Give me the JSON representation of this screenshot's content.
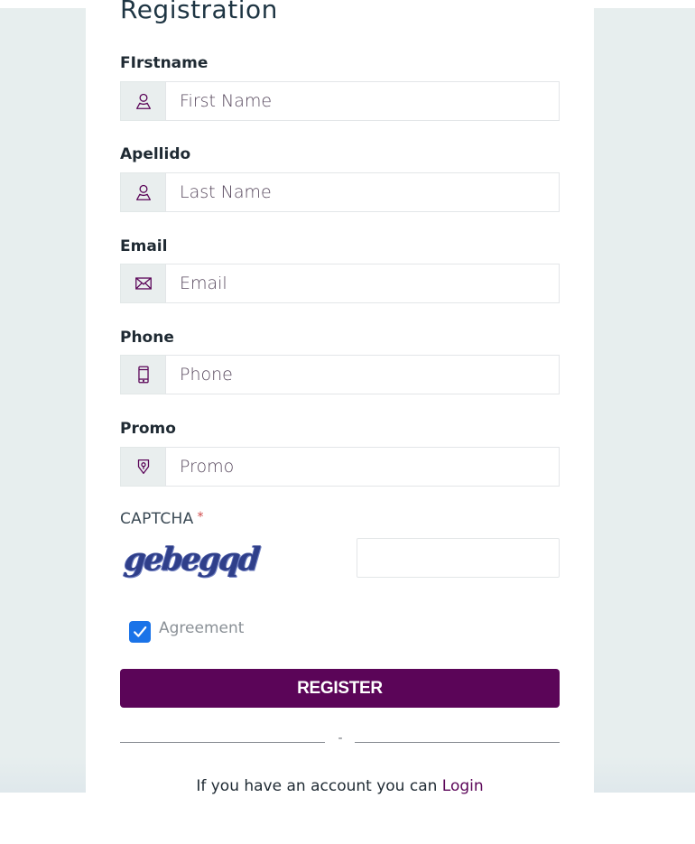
{
  "form": {
    "title": "Registration",
    "fields": [
      {
        "label": "FIrstname",
        "placeholder": "First Name",
        "icon": "user-icon"
      },
      {
        "label": "Apellido",
        "placeholder": "Last Name",
        "icon": "user-icon"
      },
      {
        "label": "Email",
        "placeholder": "Email",
        "icon": "envelope-icon"
      },
      {
        "label": "Phone",
        "placeholder": "Phone",
        "icon": "phone-icon"
      },
      {
        "label": "Promo",
        "placeholder": "Promo",
        "icon": "tag-icon"
      }
    ],
    "captcha": {
      "label": "CAPTCHA",
      "required_mark": "*",
      "image_text": "gebegqd",
      "value": ""
    },
    "agreement": {
      "label": "Agreement",
      "checked": true
    },
    "register_label": "REGISTER",
    "divider_mark": "-",
    "login_prompt": "If you have an account you can",
    "login_link": "Login"
  },
  "colors": {
    "brand": "#5b0558",
    "checkbox": "#1a73e8",
    "background": "#e7eeee",
    "icon": "#5b0558"
  }
}
